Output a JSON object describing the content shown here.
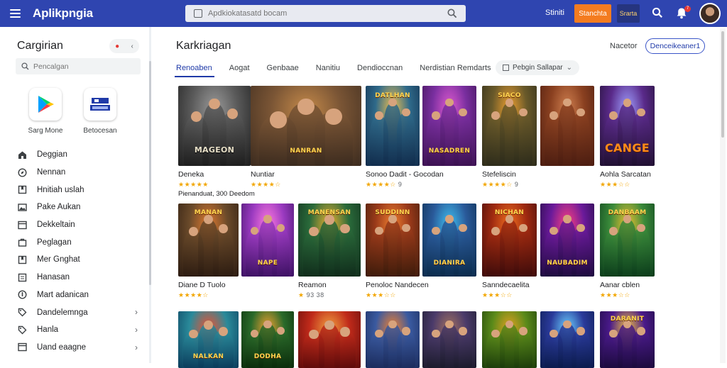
{
  "app": {
    "name": "Aplikpngia",
    "accent": "#2f45b0",
    "orange": "#f47c20"
  },
  "header": {
    "search_placeholder": "Apdkiokatasatd bocam",
    "link": "Stiniti",
    "orange_button": "Stanchta",
    "badge": "Srarta",
    "icons": [
      "menu-icon",
      "search-icon",
      "bell-icon",
      "avatar"
    ],
    "notification_count": "7"
  },
  "sidebar": {
    "title": "Cargirian",
    "search_placeholder": "Pencalgan",
    "apps": [
      {
        "label": "Sarg Mone",
        "icon": "play-store-icon"
      },
      {
        "label": "Betocesan",
        "icon": "store-icon"
      }
    ],
    "items": [
      {
        "label": "Deggian",
        "icon": "home-icon",
        "chevron": false
      },
      {
        "label": "Nennan",
        "icon": "compass-icon",
        "chevron": false
      },
      {
        "label": "Hnitiah uslah",
        "icon": "bookmark-icon",
        "chevron": false
      },
      {
        "label": "Pake Aukan",
        "icon": "image-icon",
        "chevron": false
      },
      {
        "label": "Dekkeltain",
        "icon": "window-icon",
        "chevron": false
      },
      {
        "label": "Peglagan",
        "icon": "bag-icon",
        "chevron": false
      },
      {
        "label": "Mer Gnghat",
        "icon": "bookmark-icon",
        "chevron": false
      },
      {
        "label": "Hanasan",
        "icon": "list-icon",
        "chevron": false
      },
      {
        "label": "Mart adanican",
        "icon": "globe-icon",
        "chevron": false
      },
      {
        "label": "Dandelemnga",
        "icon": "tag-icon",
        "chevron": true
      },
      {
        "label": "Hanla",
        "icon": "tag-icon",
        "chevron": true
      },
      {
        "label": "Uand eaagne",
        "icon": "window-icon",
        "chevron": true
      }
    ]
  },
  "main": {
    "title": "Karkriagan",
    "sort_label": "Nacetor",
    "action_button": "Denceikeaner1",
    "tabs": [
      "Renoaben",
      "Aogat",
      "Genbaae",
      "Nanitiu",
      "Dendioccnan",
      "Nerdistian Remdarts"
    ],
    "active_tab": 0,
    "dropdown": "Pebgin Sallapar",
    "games": [
      {
        "title": "Deneka",
        "rating": 4.5,
        "rating_text": "",
        "extra": "Pienanduat, 300 Deedom",
        "cover_text": "MAGEON",
        "palette": [
          "#1c1c1c",
          "#5a5a5a",
          "#9a9a9a"
        ]
      },
      {
        "title": "Nuntiar",
        "rating": 4,
        "rating_text": "",
        "extra": "",
        "cover_text": "NANRAN",
        "palette": [
          "#3a2a1e",
          "#7a5535",
          "#c58a4a"
        ]
      },
      {
        "title": "Sonoo Dadit - Gocodan",
        "rating": 4,
        "rating_text": "9",
        "extra": "",
        "cover_text": "DATLHAN",
        "palette": [
          "#102a4a",
          "#2f6a8a",
          "#f2c14e"
        ]
      },
      {
        "title": "",
        "rating": 0,
        "rating_text": "",
        "extra": "",
        "cover_text": "NASADREN",
        "palette": [
          "#3a114f",
          "#7a2fa0",
          "#e05bd0"
        ]
      },
      {
        "title": "Stefeliscin",
        "rating": 3.5,
        "rating_text": "9",
        "extra": "",
        "cover_text": "SIACO",
        "palette": [
          "#2b2a1a",
          "#6a5a2a",
          "#f0a030"
        ]
      },
      {
        "title": "",
        "rating": 0,
        "rating_text": "",
        "extra": "",
        "cover_text": "",
        "palette": [
          "#4a1c10",
          "#8a4020",
          "#d08050"
        ]
      },
      {
        "title": "Aohla Sarcatan",
        "rating": 3,
        "rating_text": "",
        "extra": "",
        "cover_text": "CANGE",
        "palette": [
          "#1e0f2e",
          "#5a2a8a",
          "#a0a0ff"
        ]
      },
      {
        "title": "Diane D Tuolo",
        "rating": 4,
        "rating_text": "",
        "extra": "",
        "cover_text": "MANAN",
        "palette": [
          "#2a1a10",
          "#6a4a2a",
          "#e07a30"
        ]
      },
      {
        "title": "",
        "rating": 0,
        "rating_text": "",
        "extra": "",
        "cover_text": "NAPE",
        "palette": [
          "#3a1060",
          "#9a3ac0",
          "#ff7adf"
        ]
      },
      {
        "title": "Reamon",
        "rating": 0,
        "rating_text": "93 38",
        "extra": "",
        "cover_text": "MANENSAN",
        "palette": [
          "#0f2a1a",
          "#2a6a3a",
          "#f0b030"
        ]
      },
      {
        "title": "Penoloc Nandecen",
        "rating": 3,
        "rating_text": "",
        "extra": "",
        "cover_text": "SUDDINN",
        "palette": [
          "#3a1a0a",
          "#9a3a1a",
          "#f08030"
        ]
      },
      {
        "title": "",
        "rating": 0,
        "rating_text": "",
        "extra": "",
        "cover_text": "DIANIRA",
        "palette": [
          "#0a2a4a",
          "#2a5a9a",
          "#40c0f0"
        ]
      },
      {
        "title": "Sanndecaelita",
        "rating": 3,
        "rating_text": "",
        "extra": "",
        "cover_text": "NICHAN",
        "palette": [
          "#3a0a0a",
          "#a02a10",
          "#f07020"
        ]
      },
      {
        "title": "",
        "rating": 0,
        "rating_text": "",
        "extra": "",
        "cover_text": "NAUBADIM",
        "palette": [
          "#1a0a3a",
          "#6a1a9a",
          "#ff4080"
        ]
      },
      {
        "title": "Aanar cblen",
        "rating": 3,
        "rating_text": "",
        "extra": "",
        "cover_text": "DANBAAM",
        "palette": [
          "#0a3a1a",
          "#3a8a3a",
          "#f0c030"
        ]
      },
      {
        "title": "",
        "rating": 0,
        "rating_text": "",
        "extra": "",
        "cover_text": "NALKAN",
        "palette": [
          "#0a3a5a",
          "#2a8a9a",
          "#f05030"
        ]
      },
      {
        "title": "",
        "rating": 0,
        "rating_text": "",
        "extra": "",
        "cover_text": "DODHA",
        "palette": [
          "#0a2a0a",
          "#2a6a2a",
          "#f0a030"
        ]
      },
      {
        "title": "",
        "rating": 0,
        "rating_text": "",
        "extra": "",
        "cover_text": "",
        "palette": [
          "#5a0a0a",
          "#c02a1a",
          "#f0a040"
        ]
      },
      {
        "title": "",
        "rating": 0,
        "rating_text": "",
        "extra": "",
        "cover_text": "",
        "palette": [
          "#1a2a5a",
          "#3a5aa0",
          "#f08030"
        ]
      },
      {
        "title": "",
        "rating": 0,
        "rating_text": "",
        "extra": "",
        "cover_text": "",
        "palette": [
          "#1a1a2a",
          "#4a3a6a",
          "#a07060"
        ]
      },
      {
        "title": "",
        "rating": 0,
        "rating_text": "",
        "extra": "",
        "cover_text": "",
        "palette": [
          "#1a3a0a",
          "#5a8a1a",
          "#e0a020"
        ]
      },
      {
        "title": "",
        "rating": 0,
        "rating_text": "",
        "extra": "",
        "cover_text": "",
        "palette": [
          "#0a1a4a",
          "#2a3a9a",
          "#6ad0ff"
        ]
      },
      {
        "title": "",
        "rating": 0,
        "rating_text": "",
        "extra": "",
        "cover_text": "DARANIT",
        "palette": [
          "#1a0a3a",
          "#4a1a8a",
          "#f0c040"
        ]
      }
    ]
  }
}
